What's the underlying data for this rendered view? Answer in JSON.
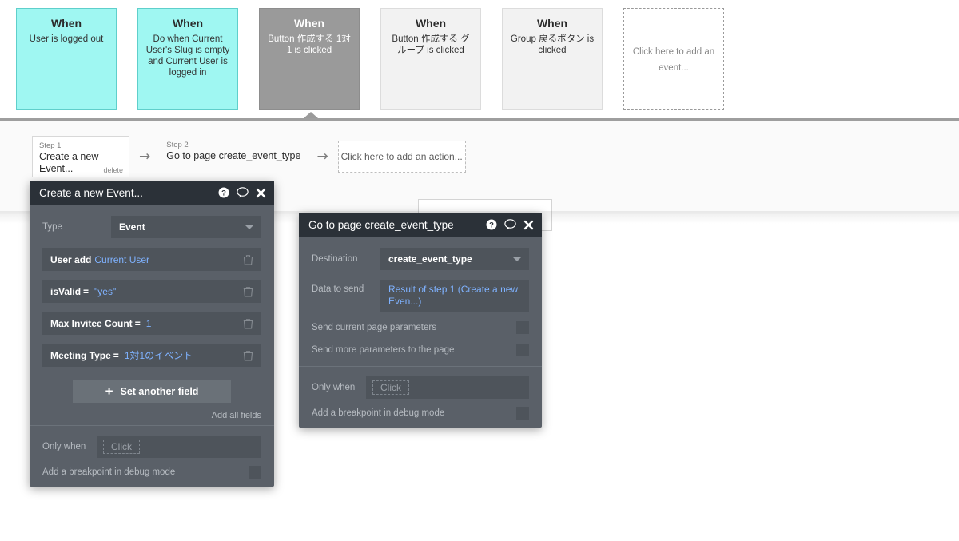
{
  "events": [
    {
      "when": "When",
      "desc": "User is logged out",
      "style": "cyan"
    },
    {
      "when": "When",
      "desc": "Do when Current User's Slug is empty and Current User is logged in",
      "style": "cyan"
    },
    {
      "when": "When",
      "desc": "Button 作成する 1対1 is clicked",
      "style": "selected"
    },
    {
      "when": "When",
      "desc": "Button 作成する グループ is clicked",
      "style": "plain"
    },
    {
      "when": "When",
      "desc": "Group 戻るボタン is clicked",
      "style": "plain"
    }
  ],
  "add_event_card": {
    "text": "Click here to add an event..."
  },
  "steps": {
    "step1": {
      "label": "Step 1",
      "title": "Create a new Event...",
      "delete": "delete"
    },
    "step2": {
      "label": "Step 2",
      "title": "Go to page create_event_type"
    },
    "add_action": {
      "text": "Click here to add an action..."
    },
    "arrow": "→"
  },
  "dialog_create_event": {
    "title": "Create a new Event...",
    "icons": {
      "help": "help-icon",
      "comment": "comment-icon",
      "close": "close-icon"
    },
    "type_row": {
      "label": "Type",
      "value": "Event"
    },
    "fields": [
      {
        "name": "User add",
        "op": "",
        "value": "Current User"
      },
      {
        "name": "isValid",
        "op": "=",
        "value": "\"yes\""
      },
      {
        "name": "Max Invitee Count",
        "op": "=",
        "value": "1"
      },
      {
        "name": "Meeting Type",
        "op": "=",
        "value": "1対1のイベント"
      }
    ],
    "set_another_field": "Set another field",
    "add_all_fields": "Add all fields",
    "only_when": {
      "label": "Only when",
      "placeholder": "Click"
    },
    "breakpoint": {
      "label": "Add a breakpoint in debug mode"
    }
  },
  "dialog_goto_page": {
    "title": "Go to page create_event_type",
    "icons": {
      "help": "help-icon",
      "comment": "comment-icon",
      "close": "close-icon"
    },
    "destination": {
      "label": "Destination",
      "value": "create_event_type"
    },
    "data_to_send": {
      "label": "Data to send",
      "value": "Result of step 1 (Create a new Even...)"
    },
    "toggles": [
      {
        "label": "Send current page parameters"
      },
      {
        "label": "Send more parameters to the page"
      }
    ],
    "only_when": {
      "label": "Only when",
      "placeholder": "Click"
    },
    "breakpoint": {
      "label": "Add a breakpoint in debug mode"
    }
  },
  "colors": {
    "card_cyan": "#9ff7f2",
    "card_selected": "#9a9a9a",
    "dialog_bg": "#5a6068",
    "dialog_title_bg": "#2b3138",
    "value_blue": "#7fb2ff"
  }
}
